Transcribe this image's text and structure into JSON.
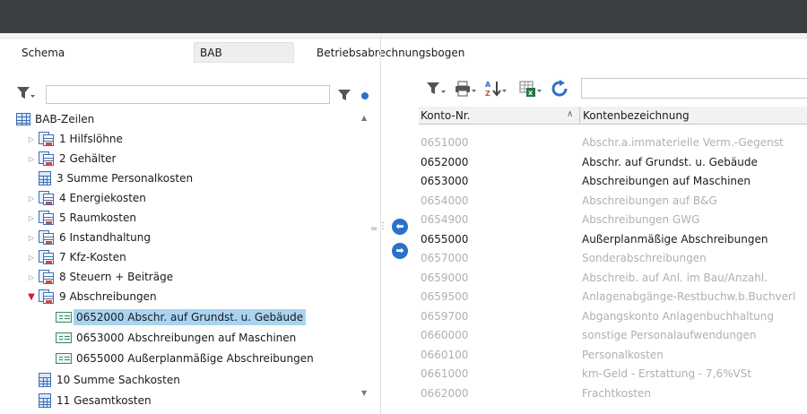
{
  "header": {
    "schema_label": "Schema",
    "schema_value": "BAB",
    "schema_description": "Betriebsabrechnungsbogen"
  },
  "left_panel": {
    "search_value": "",
    "tree": {
      "root_label": "BAB-Zeilen",
      "nodes": [
        {
          "label": "1  Hilfslöhne",
          "type": "group",
          "expand": "collapsed"
        },
        {
          "label": "2  Gehälter",
          "type": "group",
          "expand": "collapsed"
        },
        {
          "label": "3  Summe Personalkosten",
          "type": "sum",
          "expand": "none"
        },
        {
          "label": "4  Energiekosten",
          "type": "group",
          "expand": "collapsed"
        },
        {
          "label": "5  Raumkosten",
          "type": "group",
          "expand": "collapsed"
        },
        {
          "label": "6  Instandhaltung",
          "type": "group",
          "expand": "collapsed"
        },
        {
          "label": "7  Kfz-Kosten",
          "type": "group",
          "expand": "collapsed"
        },
        {
          "label": "8  Steuern + Beiträge",
          "type": "group",
          "expand": "collapsed"
        },
        {
          "label": "9  Abschreibungen",
          "type": "group",
          "expand": "expanded"
        },
        {
          "label": "0652000  Abschr. auf Grundst. u. Gebäude",
          "type": "account",
          "selected": true
        },
        {
          "label": "0653000  Abschreibungen auf Maschinen",
          "type": "account"
        },
        {
          "label": "0655000  Außerplanmäßige Abschreibungen",
          "type": "account"
        },
        {
          "label": "10  Summe Sachkosten",
          "type": "sum",
          "expand": "none"
        },
        {
          "label": "11  Gesamtkosten",
          "type": "sum",
          "expand": "none"
        }
      ]
    }
  },
  "right_panel": {
    "search_value": "",
    "columns": {
      "konto": "Konto-Nr.",
      "bezeichnung": "Kontenbezeichnung"
    },
    "rows": [
      {
        "konto": "0651000",
        "bezeichnung": "Abschr.a.immaterielle Verm.-Gegenst",
        "assigned": false
      },
      {
        "konto": "0652000",
        "bezeichnung": "Abschr. auf Grundst. u. Gebäude",
        "assigned": true
      },
      {
        "konto": "0653000",
        "bezeichnung": "Abschreibungen auf Maschinen",
        "assigned": true
      },
      {
        "konto": "0654000",
        "bezeichnung": "Abschreibungen auf B&G",
        "assigned": false
      },
      {
        "konto": "0654900",
        "bezeichnung": "Abschreibungen GWG",
        "assigned": false
      },
      {
        "konto": "0655000",
        "bezeichnung": "Außerplanmäßige Abschreibungen",
        "assigned": true
      },
      {
        "konto": "0657000",
        "bezeichnung": "Sonderabschreibungen",
        "assigned": false
      },
      {
        "konto": "0659000",
        "bezeichnung": "Abschreib. auf Anl. im Bau/Anzahl.",
        "assigned": false
      },
      {
        "konto": "0659500",
        "bezeichnung": "Anlagenabgänge-Restbuchw.b.Buchverl",
        "assigned": false
      },
      {
        "konto": "0659700",
        "bezeichnung": "Abgangskonto Anlagenbuchhaltung",
        "assigned": false
      },
      {
        "konto": "0660000",
        "bezeichnung": "sonstige Personalaufwendungen",
        "assigned": false
      },
      {
        "konto": "0660100",
        "bezeichnung": "Personalkosten",
        "assigned": false
      },
      {
        "konto": "0661000",
        "bezeichnung": "km-Geld - Erstattung - 7,6%VSt",
        "assigned": false
      },
      {
        "konto": "0662000",
        "bezeichnung": "Frachtkosten",
        "assigned": false
      }
    ]
  },
  "colors": {
    "accent": "#2a72c9",
    "selection": "#a9d3f0",
    "titlebar": "#3c3f41",
    "dim_text": "#b0b0b0"
  }
}
